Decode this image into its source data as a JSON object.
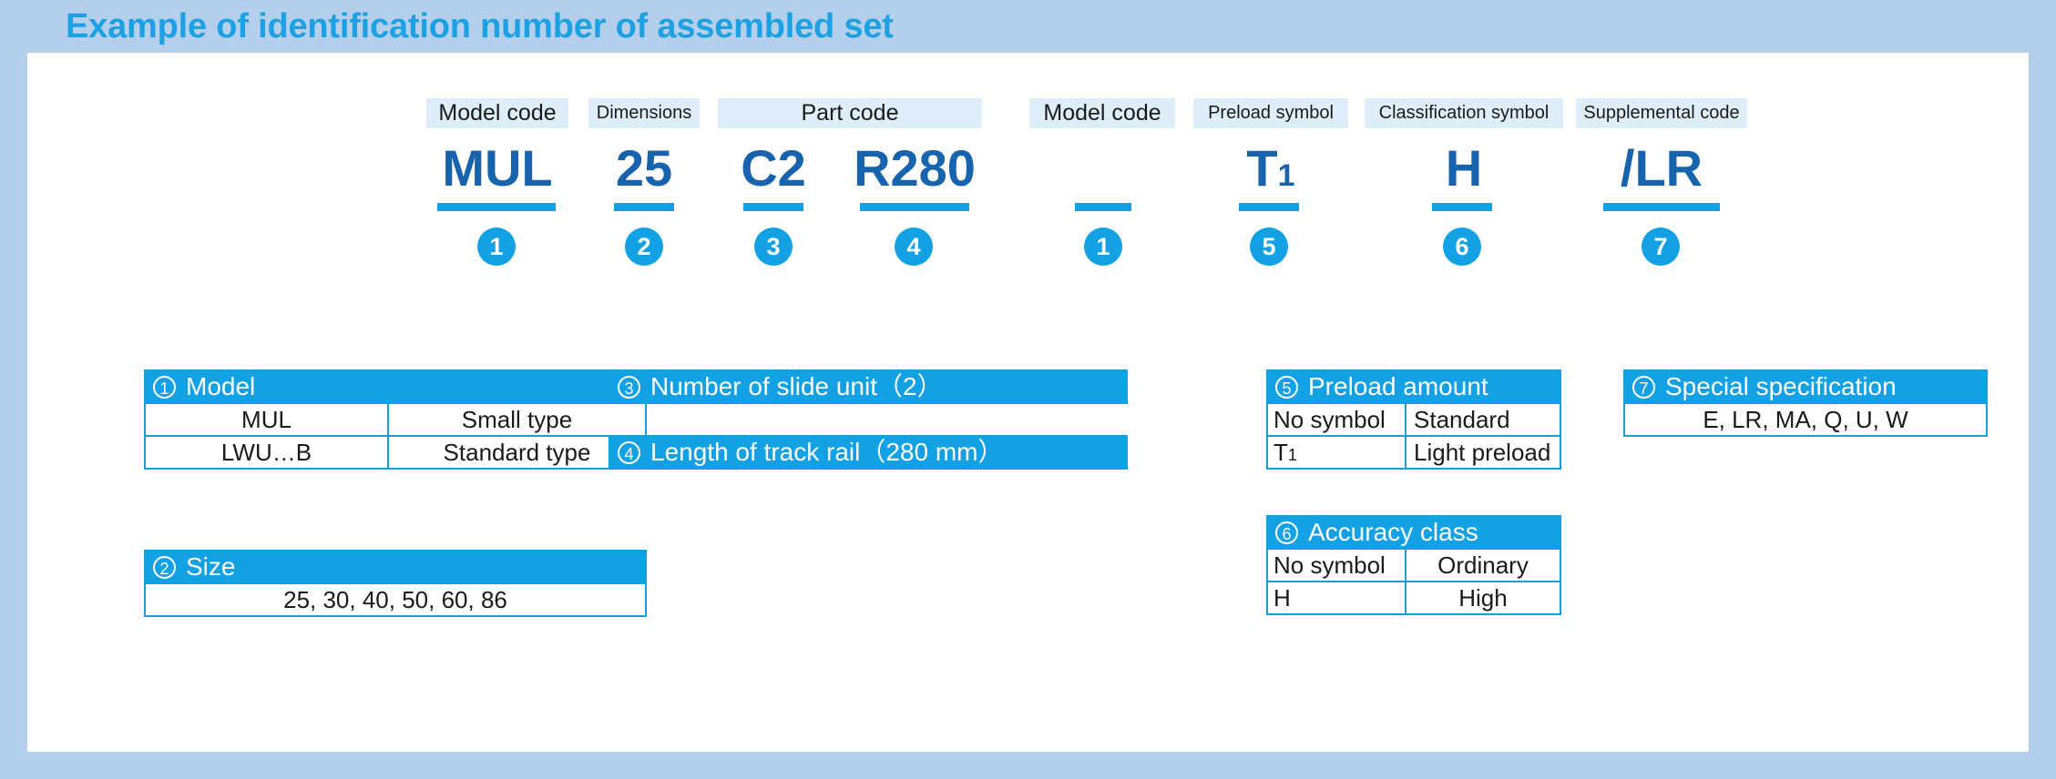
{
  "title": "Example of identification number of assembled set",
  "colors": {
    "frame": "#b4cfec",
    "accent": "#12a1e5",
    "code_text": "#1763ad",
    "caption_bg": "#ddeef9",
    "panel_bg": "#ffffff"
  },
  "code_strip": {
    "captions": [
      {
        "label": "Model code",
        "size": "normal"
      },
      {
        "label": "Dimensions",
        "size": "small"
      },
      {
        "label": "Part code",
        "size": "normal"
      },
      {
        "label": "Model code",
        "size": "normal"
      },
      {
        "label": "Preload symbol",
        "size": "small"
      },
      {
        "label": "Classification symbol",
        "size": "small"
      },
      {
        "label": "Supplemental code",
        "size": "small"
      }
    ],
    "segments": [
      {
        "code": "MUL",
        "sub": "",
        "badge": "1"
      },
      {
        "code": "25",
        "sub": "",
        "badge": "2"
      },
      {
        "code": "C2",
        "sub": "",
        "badge": "3"
      },
      {
        "code": "R280",
        "sub": "",
        "badge": "4"
      },
      {
        "code": "",
        "sub": "",
        "badge": "1"
      },
      {
        "code": "T",
        "sub": "1",
        "badge": "5"
      },
      {
        "code": "H",
        "sub": "",
        "badge": "6"
      },
      {
        "code": "/LR",
        "sub": "",
        "badge": "7"
      }
    ]
  },
  "tables": {
    "model": {
      "num": "1",
      "header": "Model",
      "rows": [
        {
          "symbol": "MUL",
          "desc": "Small type"
        },
        {
          "symbol": "LWU…B",
          "desc": "Standard type"
        }
      ]
    },
    "size": {
      "num": "2",
      "header": "Size",
      "value": "25, 30, 40, 50, 60, 86"
    },
    "slide_unit": {
      "num": "3",
      "header": "Number of slide unit（2）"
    },
    "track_rail": {
      "num": "4",
      "header": "Length of track rail（280 mm）"
    },
    "preload": {
      "num": "5",
      "header": "Preload amount",
      "rows": [
        {
          "symbol": "No symbol",
          "sub": "",
          "desc": "Standard"
        },
        {
          "symbol": "T",
          "sub": "1",
          "desc": "Light preload"
        }
      ]
    },
    "accuracy": {
      "num": "6",
      "header": "Accuracy class",
      "rows": [
        {
          "symbol": "No symbol",
          "sub": "",
          "desc": "Ordinary"
        },
        {
          "symbol": "H",
          "sub": "",
          "desc": "High"
        }
      ]
    },
    "special": {
      "num": "7",
      "header": "Special specification",
      "value": "E, LR, MA, Q, U, W"
    }
  }
}
